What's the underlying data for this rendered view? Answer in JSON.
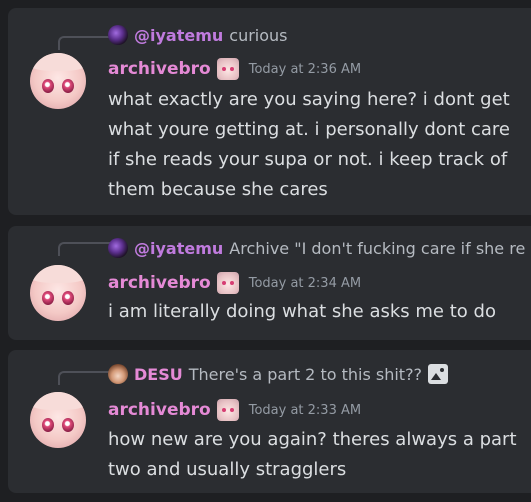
{
  "messages": [
    {
      "reply": {
        "name": "@iyatemu",
        "text": "curious",
        "avatar_icon": "dark-avatar-icon",
        "has_image": false
      },
      "username": "archivebro",
      "timestamp": "Today at 2:36 AM",
      "content": "what exactly are you saying here? i dont get what youre getting at. i personally dont care if she reads your supa or not. i keep track of them because she cares"
    },
    {
      "reply": {
        "name": "@iyatemu",
        "text": "Archive \"I don't fucking care if she re",
        "avatar_icon": "dark-avatar-icon",
        "has_image": false
      },
      "username": "archivebro",
      "timestamp": "Today at 2:34 AM",
      "content": "i am literally doing what she asks me to do"
    },
    {
      "reply": {
        "name": "DESU",
        "text": "There's a part 2 to this shit??",
        "avatar_icon": "desu-avatar-icon",
        "has_image": true
      },
      "username": "archivebro",
      "timestamp": "Today at 2:33 AM",
      "content": "how new are you again? theres always a part two and usually stragglers"
    }
  ],
  "colors": {
    "background": "#1e1f22",
    "message_bg": "#2b2d31",
    "username": "#e58ad6",
    "reply_iyatemu": "#c07bde",
    "reply_desu": "#e58ad6",
    "text": "#dbdee1",
    "muted": "#949ba4"
  }
}
